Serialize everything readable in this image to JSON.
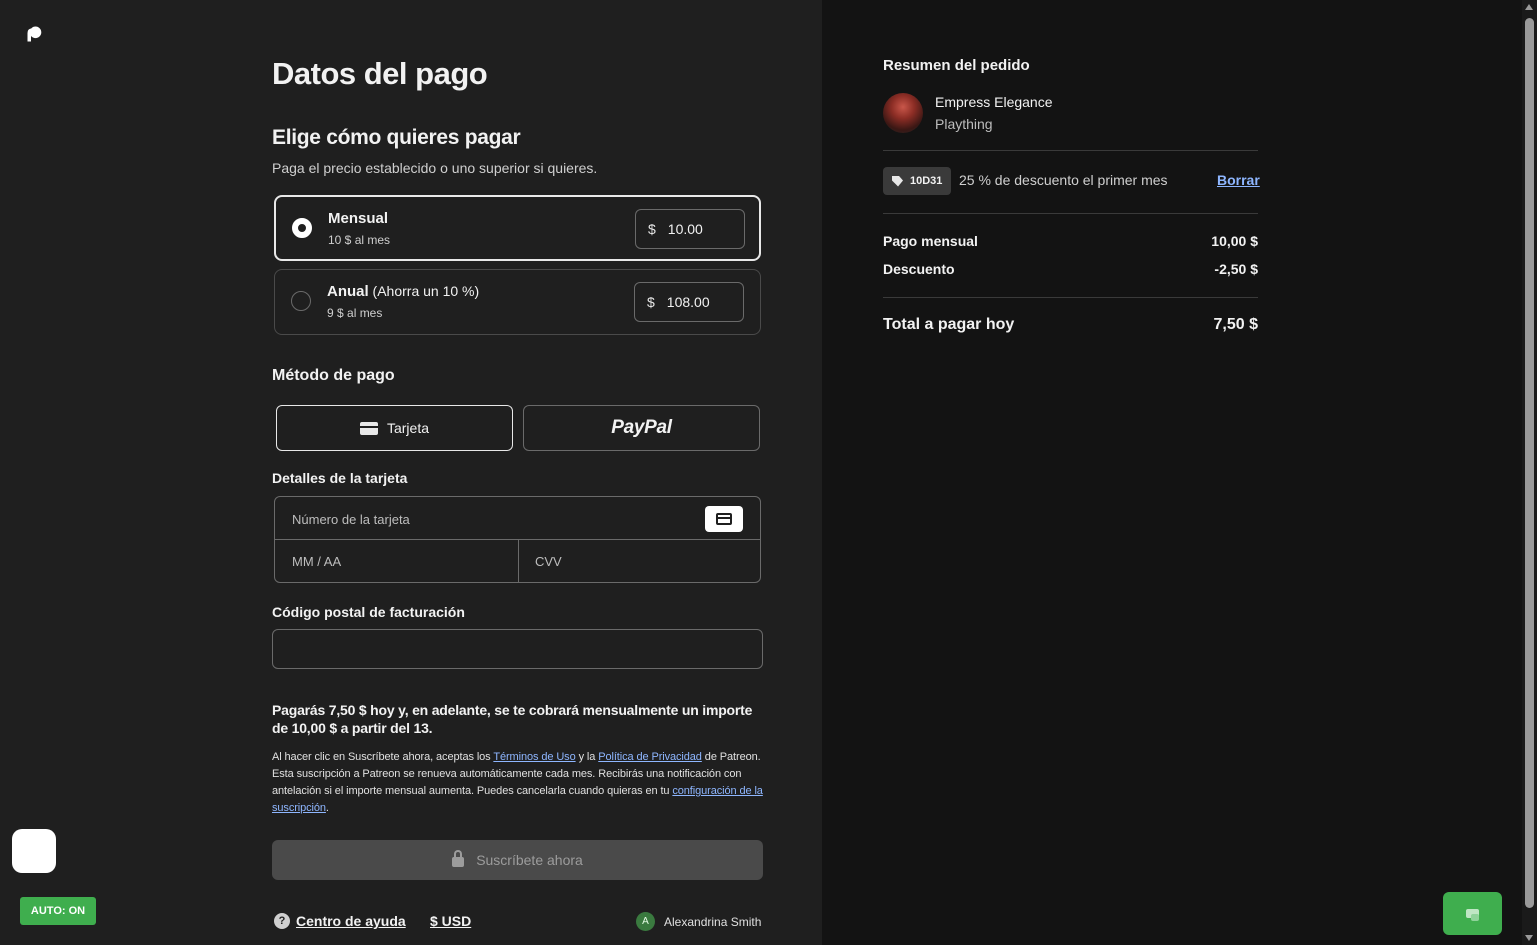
{
  "page": {
    "title": "Datos del pago",
    "choose_title": "Elige cómo quieres pagar",
    "choose_subtitle": "Paga el precio establecido o uno superior si quieres."
  },
  "plans": [
    {
      "name": "Mensual",
      "extra": "",
      "note": "10 $ al mes",
      "currency": "$",
      "value": "10.00",
      "selected": true
    },
    {
      "name": "Anual",
      "extra": " (Ahorra un 10 %)",
      "note": "9 $ al mes",
      "currency": "$",
      "value": "108.00",
      "selected": false
    }
  ],
  "payment_method": {
    "title": "Método de pago",
    "card_label": "Tarjeta",
    "paypal_label": "PayPal"
  },
  "card_details": {
    "title": "Detalles de la tarjeta",
    "number_placeholder": "Número de la tarjeta",
    "expiry_placeholder": "MM / AA",
    "cvv_placeholder": "CVV"
  },
  "zip": {
    "title": "Código postal de facturación",
    "value": ""
  },
  "notice": {
    "bold": "Pagarás 7,50 $ hoy y, en adelante, se te cobrará mensualmente un importe de 10,00 $ a partir del 13.",
    "legal_1": "Al hacer clic en Suscríbete ahora, aceptas los ",
    "terms_link": "Términos de Uso",
    "legal_2": " y la ",
    "privacy_link": "Política de Privacidad",
    "legal_3": " de Patreon. Esta suscripción a Patreon se renueva automáticamente cada mes. Recibirás una notificación con antelación si el importe mensual aumenta. Puedes cancelarla cuando quieras en tu ",
    "settings_link": "configuración de la suscripción",
    "legal_4": "."
  },
  "subscribe_label": "Suscríbete ahora",
  "footer": {
    "help": "Centro de ayuda",
    "currency": "$ USD",
    "user_initial": "A",
    "user_name": "Alexandrina Smith"
  },
  "auto_badge": "AUTO: ON",
  "summary": {
    "title": "Resumen del pedido",
    "creator_name": "Empress Elegance",
    "creator_tier": "Plaything",
    "coupon_code": "10D31",
    "coupon_desc": "25 % de descuento el primer mes",
    "coupon_remove": "Borrar",
    "rows": [
      {
        "label": "Pago mensual",
        "value": "10,00 $"
      },
      {
        "label": "Descuento",
        "value": "-2,50 $"
      }
    ],
    "total_label": "Total a pagar hoy",
    "total_value": "7,50 $"
  },
  "colors": {
    "page_bg": "#1f1f1f",
    "summary_bg": "#131313",
    "link": "#8eb6ff",
    "accent_green": "#3fae4e"
  }
}
